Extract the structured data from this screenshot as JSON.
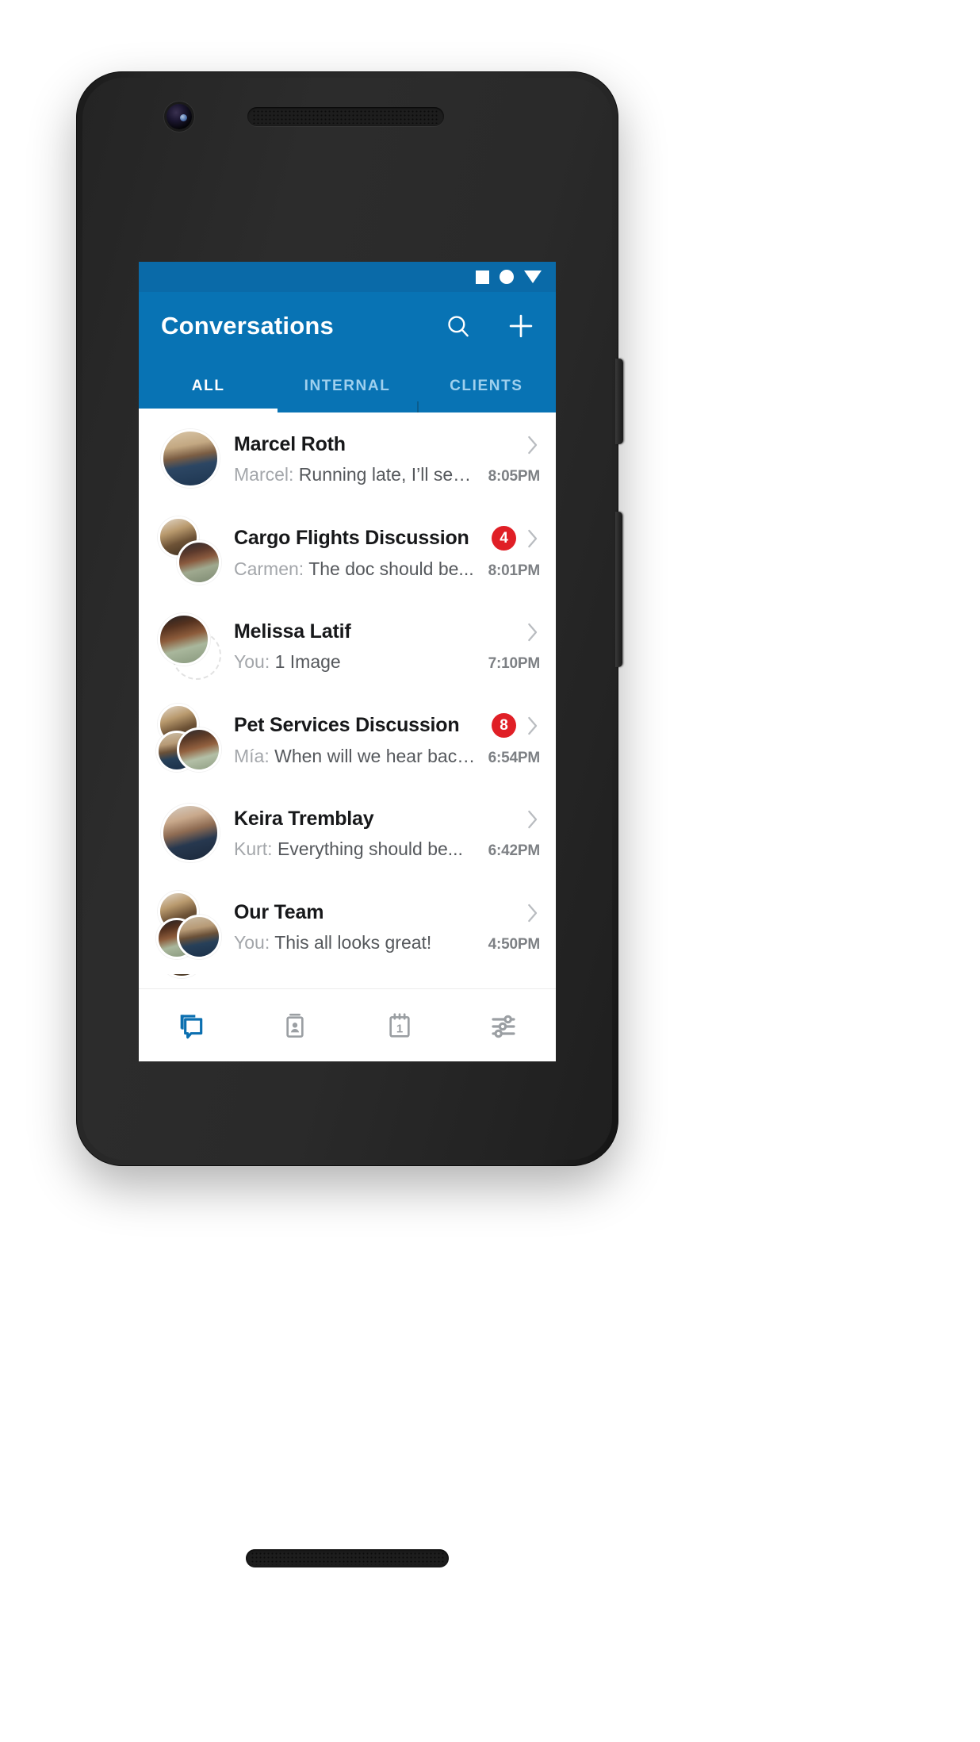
{
  "statusbar": {
    "icons": [
      "square-icon",
      "circle-icon",
      "triangle-down-icon"
    ]
  },
  "appbar": {
    "title": "Conversations",
    "search_label": "search-icon",
    "add_label": "plus-icon"
  },
  "tabs": [
    {
      "label": "ALL",
      "active": true
    },
    {
      "label": "INTERNAL",
      "active": false
    },
    {
      "label": "CLIENTS",
      "active": false
    }
  ],
  "conversations": [
    {
      "title": "Marcel Roth",
      "sender": "Marcel:",
      "preview": "Running late, I’ll send...",
      "time": "8:05PM",
      "badge": "",
      "avatar_type": "single"
    },
    {
      "title": "Cargo Flights Discussion",
      "sender": "Carmen:",
      "preview": "The doc should be...",
      "time": "8:01PM",
      "badge": "4",
      "avatar_type": "group2"
    },
    {
      "title": "Melissa Latif",
      "sender": "You:",
      "preview": "1 Image",
      "time": "7:10PM",
      "badge": "",
      "avatar_type": "single-ghost"
    },
    {
      "title": "Pet Services Discussion",
      "sender": "Mía:",
      "preview": "When will we hear back...",
      "time": "6:54PM",
      "badge": "8",
      "avatar_type": "group3"
    },
    {
      "title": "Keira Tremblay",
      "sender": "Kurt:",
      "preview": "Everything should be...",
      "time": "6:42PM",
      "badge": "",
      "avatar_type": "single"
    },
    {
      "title": "Our Team",
      "sender": "You:",
      "preview": "This all looks great!",
      "time": "4:50PM",
      "badge": "",
      "avatar_type": "group3"
    }
  ],
  "bottom_nav": [
    {
      "name": "conversations-tab",
      "icon": "chat-bubbles-icon",
      "active": true
    },
    {
      "name": "contacts-tab",
      "icon": "contact-card-icon",
      "active": false
    },
    {
      "name": "calendar-tab",
      "icon": "calendar-icon",
      "active": false,
      "day": "1"
    },
    {
      "name": "settings-tab",
      "icon": "sliders-icon",
      "active": false
    }
  ],
  "android_nav": {
    "back": "back-chevron-icon",
    "home": "home-pill-icon"
  },
  "colors": {
    "brand_blue": "#0873b4",
    "statusbar_blue": "#0a6aa8",
    "badge_red": "#e01f26",
    "title_text": "#17181a",
    "snippet_text": "#55585c",
    "muted_text": "#a3a6aa",
    "time_text": "#7d8084",
    "tab_inactive": "#9fd0ee"
  }
}
